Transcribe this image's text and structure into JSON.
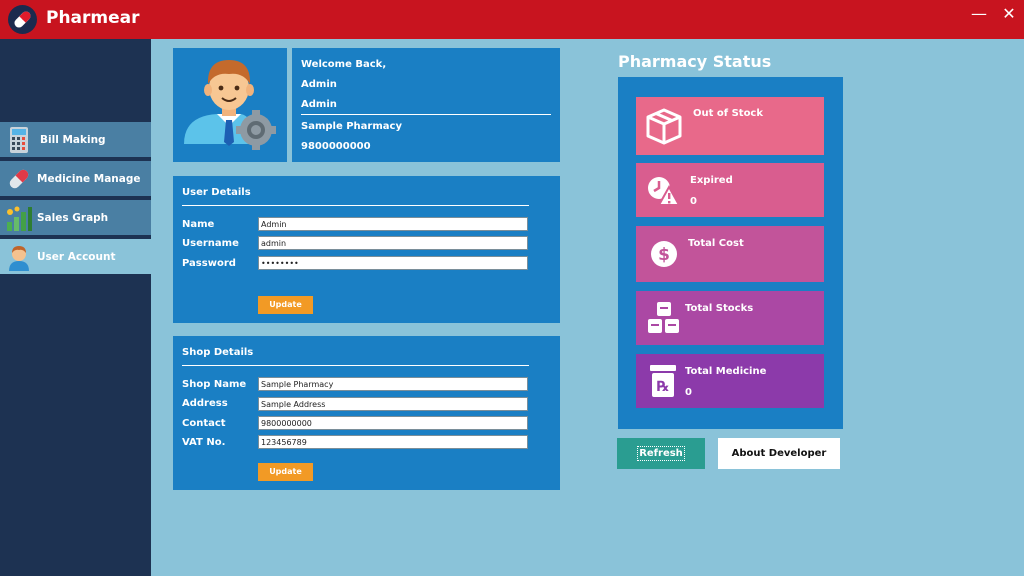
{
  "app": {
    "title": "Pharmear",
    "close_glyph": "✕",
    "min_glyph": "—"
  },
  "sidebar": {
    "items": [
      {
        "label": "Bill Making",
        "icon": "calculator-icon"
      },
      {
        "label": "Medicine Manage",
        "icon": "pill-icon"
      },
      {
        "label": "Sales Graph",
        "icon": "bar-chart-icon"
      },
      {
        "label": "User Account",
        "icon": "user-icon",
        "active": true
      }
    ]
  },
  "profile": {
    "greeting": "Welcome Back,",
    "name": "Admin",
    "role": "Admin",
    "shop": "Sample Pharmacy",
    "phone": "9800000000"
  },
  "user_details": {
    "title": "User Details",
    "name_label": "Name",
    "name_value": "Admin",
    "username_label": "Username",
    "username_value": "admin",
    "password_label": "Password",
    "password_value": "••••••••",
    "update_label": "Update"
  },
  "shop_details": {
    "title": "Shop Details",
    "shop_name_label": "Shop Name",
    "shop_name_value": "Sample Pharmacy",
    "address_label": "Address",
    "address_value": "Sample Address",
    "contact_label": "Contact",
    "contact_value": "9800000000",
    "vat_label": "VAT No.",
    "vat_value": "123456789",
    "update_label": "Update"
  },
  "status": {
    "title": "Pharmacy Status",
    "cards": [
      {
        "label": "Out of Stock",
        "value": "",
        "color": "#e8698a",
        "icon": "box-icon"
      },
      {
        "label": "Expired",
        "value": "0",
        "color": "#d95d8f",
        "icon": "expired-warning-icon"
      },
      {
        "label": "Total Cost",
        "value": "",
        "color": "#c2549a",
        "icon": "dollar-icon"
      },
      {
        "label": "Total Stocks",
        "value": "",
        "color": "#ab48a4",
        "icon": "stacked-boxes-icon"
      },
      {
        "label": "Total Medicine",
        "value": "0",
        "color": "#8c3aaa",
        "icon": "rx-bottle-icon"
      }
    ],
    "refresh_label": "Refresh",
    "about_label": "About Developer"
  },
  "colors": {
    "titlebar": "#c8141f",
    "sidebar": "#1d3252",
    "panel": "#1a7fc4",
    "background": "#8ac3d9",
    "accent": "#f29a25",
    "refresh": "#2a9d91"
  }
}
